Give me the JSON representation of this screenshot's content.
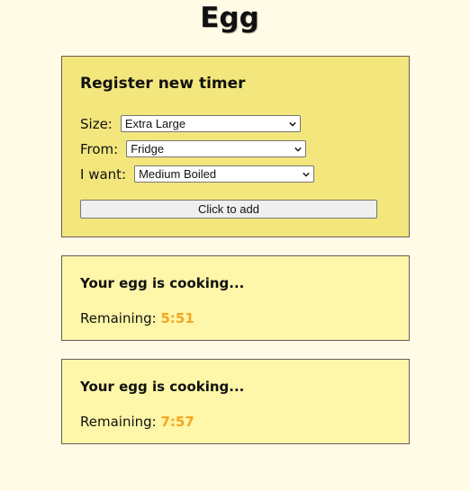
{
  "header": {
    "title": "Egg"
  },
  "register": {
    "title": "Register new timer",
    "size_label": "Size:",
    "size_value": "Extra Large",
    "from_label": "From:",
    "from_value": "Fridge",
    "want_label": "I want:",
    "want_value": "Medium Boiled",
    "button_label": "Click to add"
  },
  "timers": [
    {
      "title": "Your egg is cooking...",
      "remaining_label": "Remaining:",
      "remaining_value": "5:51"
    },
    {
      "title": "Your egg is cooking...",
      "remaining_label": "Remaining:",
      "remaining_value": "7:57"
    }
  ],
  "colors": {
    "background": "#fffbe6",
    "register_card": "#f3e67c",
    "timer_card": "#fef6a8",
    "remaining_accent": "#f5a623"
  },
  "icons": {
    "select_arrow": "chevron-down-icon"
  }
}
